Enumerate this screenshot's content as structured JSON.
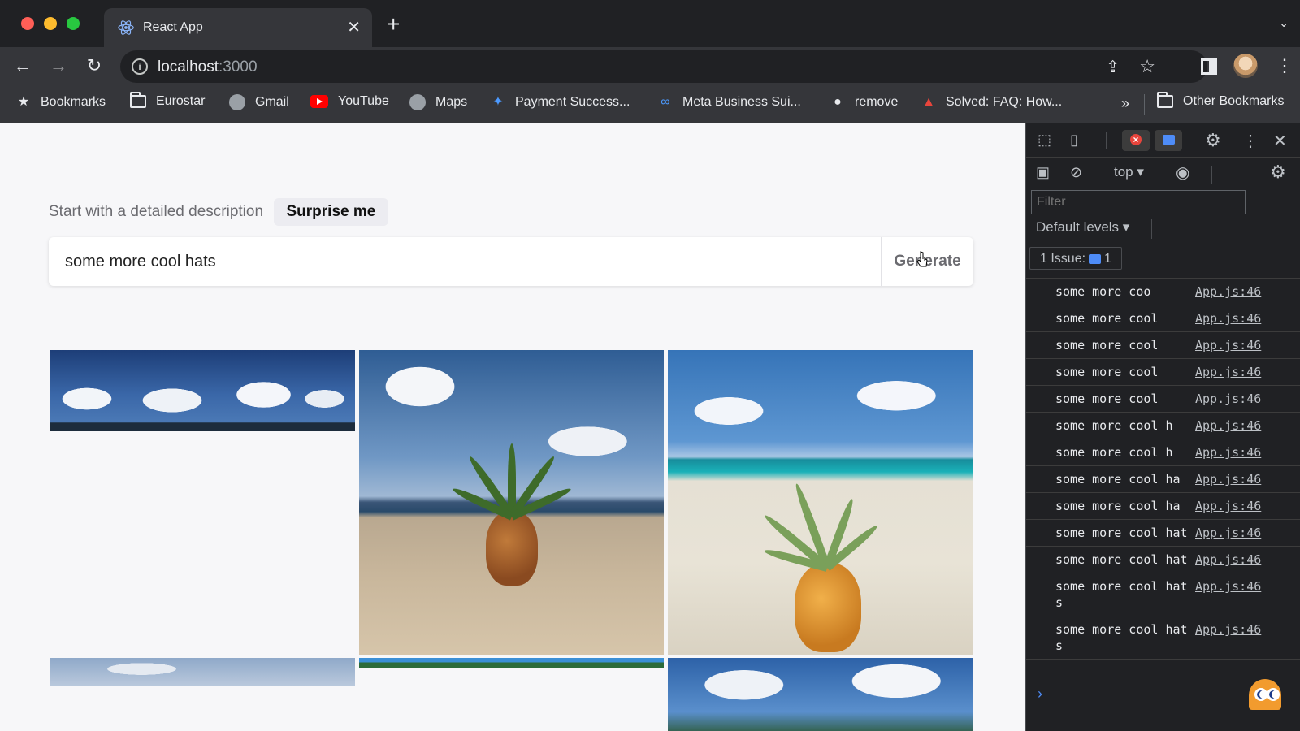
{
  "browser": {
    "tab_title": "React App",
    "url_host": "localhost",
    "url_port": ":3000",
    "bookmarks": [
      {
        "label": "Bookmarks",
        "icon": "star-icon"
      },
      {
        "label": "Eurostar",
        "icon": "folder-icon"
      },
      {
        "label": "Gmail",
        "icon": "globe-icon"
      },
      {
        "label": "YouTube",
        "icon": "youtube-icon"
      },
      {
        "label": "Maps",
        "icon": "globe-icon"
      },
      {
        "label": "Payment Success...",
        "icon": "jira-icon"
      },
      {
        "label": "Meta Business Sui...",
        "icon": "meta-icon"
      },
      {
        "label": "remove",
        "icon": "github-icon"
      },
      {
        "label": "Solved: FAQ: How...",
        "icon": "adobe-icon"
      }
    ],
    "other_bookmarks": "Other Bookmarks",
    "overflow": "»"
  },
  "app": {
    "prompt_label": "Start with a detailed description",
    "surprise_label": "Surprise me",
    "search_value": "some more cool hats",
    "generate_label": "Generate"
  },
  "devtools": {
    "context": "top",
    "filter_placeholder": "Filter",
    "levels": "Default levels",
    "issues_label": "1 Issue:",
    "issues_count": "1",
    "source": "App.js:46",
    "logs": [
      "some more coo",
      "some more cool",
      "some more cool",
      "some more cool",
      "some more cool",
      "some more cool h",
      "some more cool h",
      "some more cool ha",
      "some more cool ha",
      "some more cool hat",
      "some more cool hat",
      "some more cool hats",
      "some more cool hats"
    ]
  }
}
